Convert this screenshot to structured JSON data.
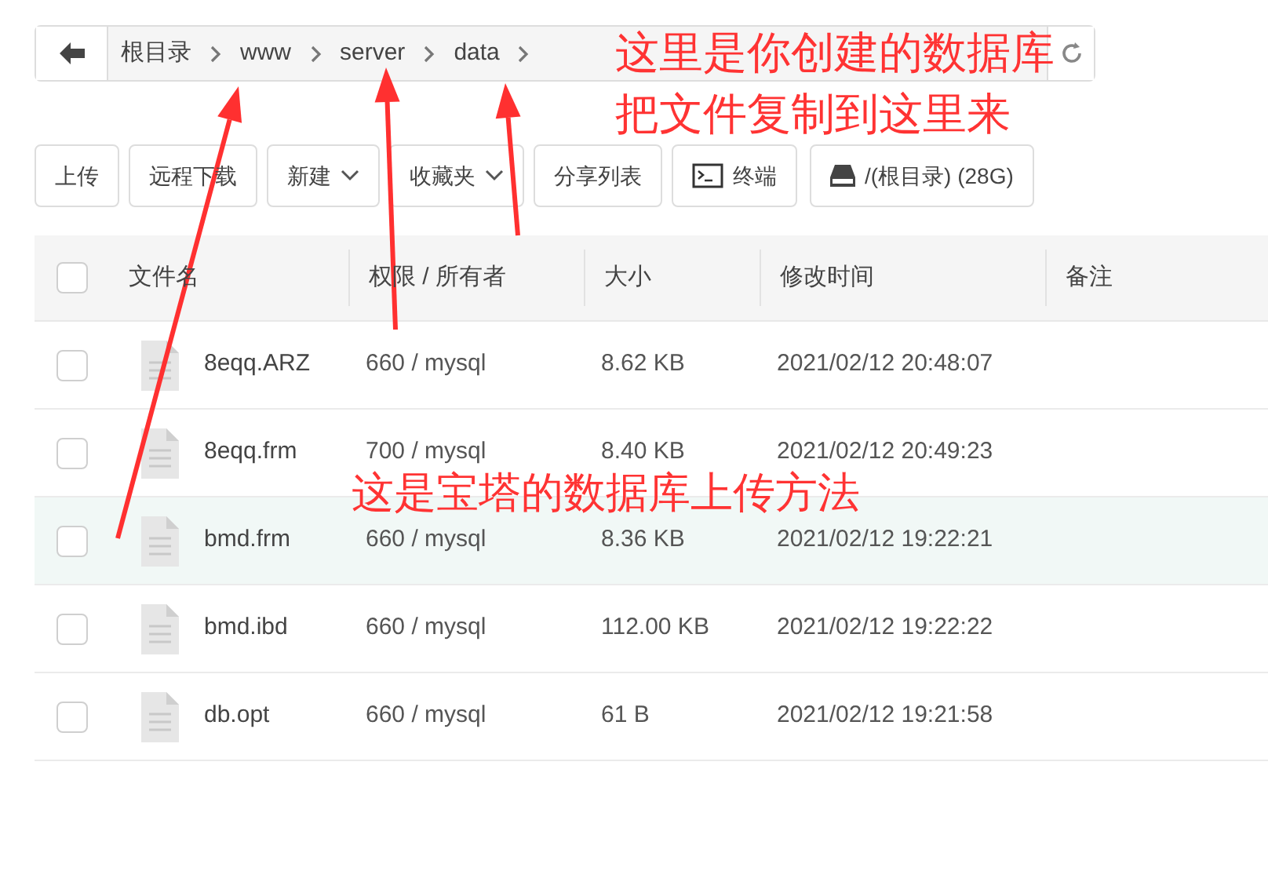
{
  "breadcrumb": {
    "items": [
      "根目录",
      "www",
      "server",
      "data"
    ]
  },
  "toolbar": {
    "buttons": [
      {
        "label": "上传",
        "kind": "plain"
      },
      {
        "label": "远程下载",
        "kind": "plain"
      },
      {
        "label": "新建",
        "kind": "dropdown"
      },
      {
        "label": "收藏夹",
        "kind": "dropdown"
      },
      {
        "label": "分享列表",
        "kind": "plain"
      },
      {
        "label": "终端",
        "kind": "terminal"
      },
      {
        "label": "/(根目录) (28G)",
        "kind": "disk"
      }
    ]
  },
  "table": {
    "select_all_checked": false,
    "columns": [
      "文件名",
      "权限 / 所有者",
      "大小",
      "修改时间",
      "备注"
    ],
    "rows": [
      {
        "name": "8eqq.ARZ",
        "permission": "660 / mysql",
        "size": "8.62 KB",
        "modified": "2021/02/12 20:48:07",
        "checked": false,
        "selected": false
      },
      {
        "name": "8eqq.frm",
        "permission": "700 / mysql",
        "size": "8.40 KB",
        "modified": "2021/02/12 20:49:23",
        "checked": false,
        "selected": false
      },
      {
        "name": "bmd.frm",
        "permission": "660 / mysql",
        "size": "8.36 KB",
        "modified": "2021/02/12 19:22:21",
        "checked": false,
        "selected": true
      },
      {
        "name": "bmd.ibd",
        "permission": "660 / mysql",
        "size": "112.00 KB",
        "modified": "2021/02/12 19:22:22",
        "checked": false,
        "selected": false
      },
      {
        "name": "db.opt",
        "permission": "660 / mysql",
        "size": "61 B",
        "modified": "2021/02/12 19:21:58",
        "checked": false,
        "selected": false
      }
    ]
  },
  "annotations": [
    "这里是你创建的数据库",
    "把文件复制到这里来",
    "这是宝塔的数据库上传方法"
  ]
}
